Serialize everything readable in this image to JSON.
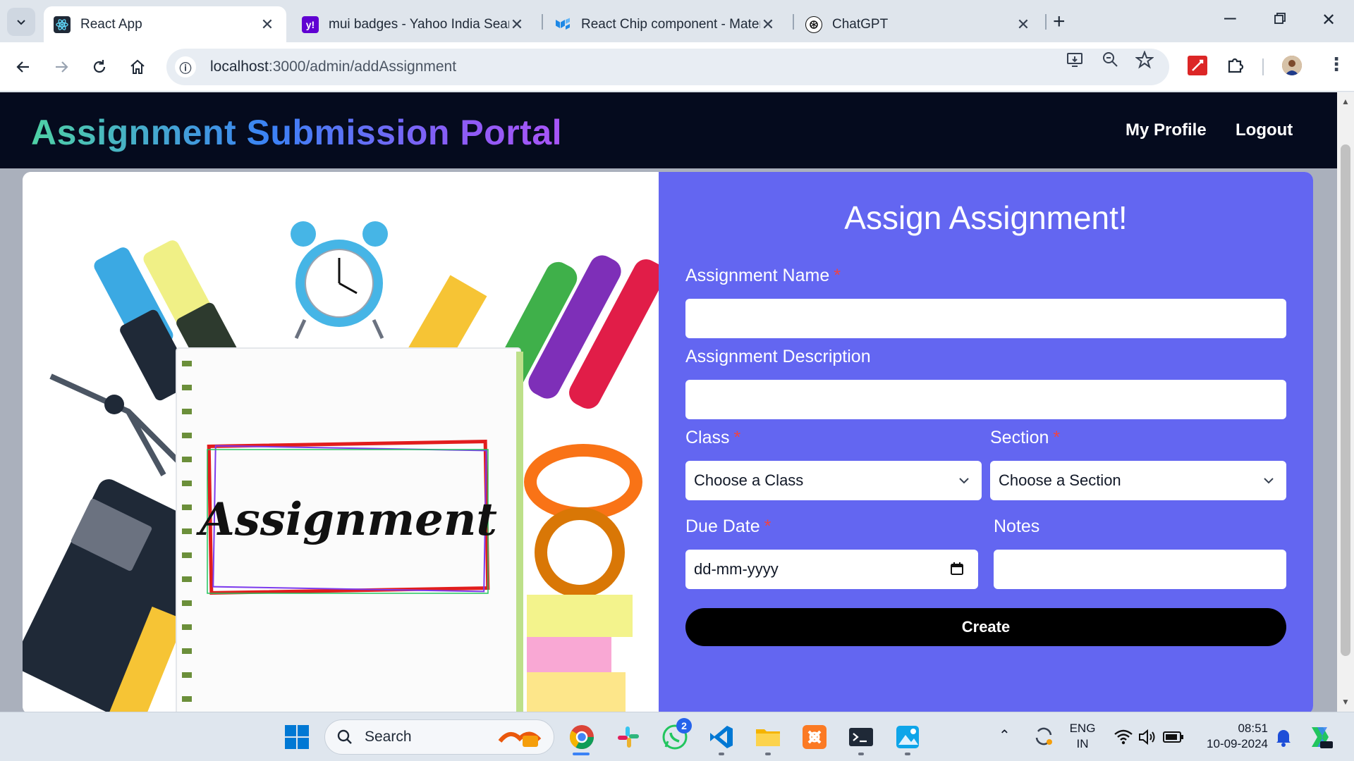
{
  "browser": {
    "tabs": [
      {
        "title": "React App",
        "favicon": "react-icon"
      },
      {
        "title": "mui badges - Yahoo India Searc",
        "favicon": "yahoo-icon"
      },
      {
        "title": "React Chip component - Materi",
        "favicon": "mui-icon"
      },
      {
        "title": "ChatGPT",
        "favicon": "chatgpt-icon"
      }
    ],
    "url_host": "localhost",
    "url_path": ":3000/admin/addAssignment"
  },
  "app": {
    "brand": "Assignment Submission Portal",
    "nav": {
      "profile": "My Profile",
      "logout": "Logout"
    },
    "illustration_text": "Assignment",
    "form": {
      "title": "Assign Assignment!",
      "name_label": "Assignment Name",
      "description_label": "Assignment Description",
      "class_label": "Class",
      "class_value": "Choose a Class",
      "section_label": "Section",
      "section_value": "Choose a Section",
      "due_label": "Due Date",
      "due_placeholder": "dd-mm-yyyy",
      "notes_label": "Notes",
      "required_mark": "*",
      "submit": "Create"
    },
    "colors": {
      "nav_bg": "#050b1e",
      "form_bg": "#6366f1",
      "button_bg": "#000000",
      "required": "#ef4444"
    }
  },
  "taskbar": {
    "search_label": "Search",
    "whatsapp_badge": "2",
    "lang_line1": "ENG",
    "lang_line2": "IN",
    "time": "08:51",
    "date": "10-09-2024"
  }
}
